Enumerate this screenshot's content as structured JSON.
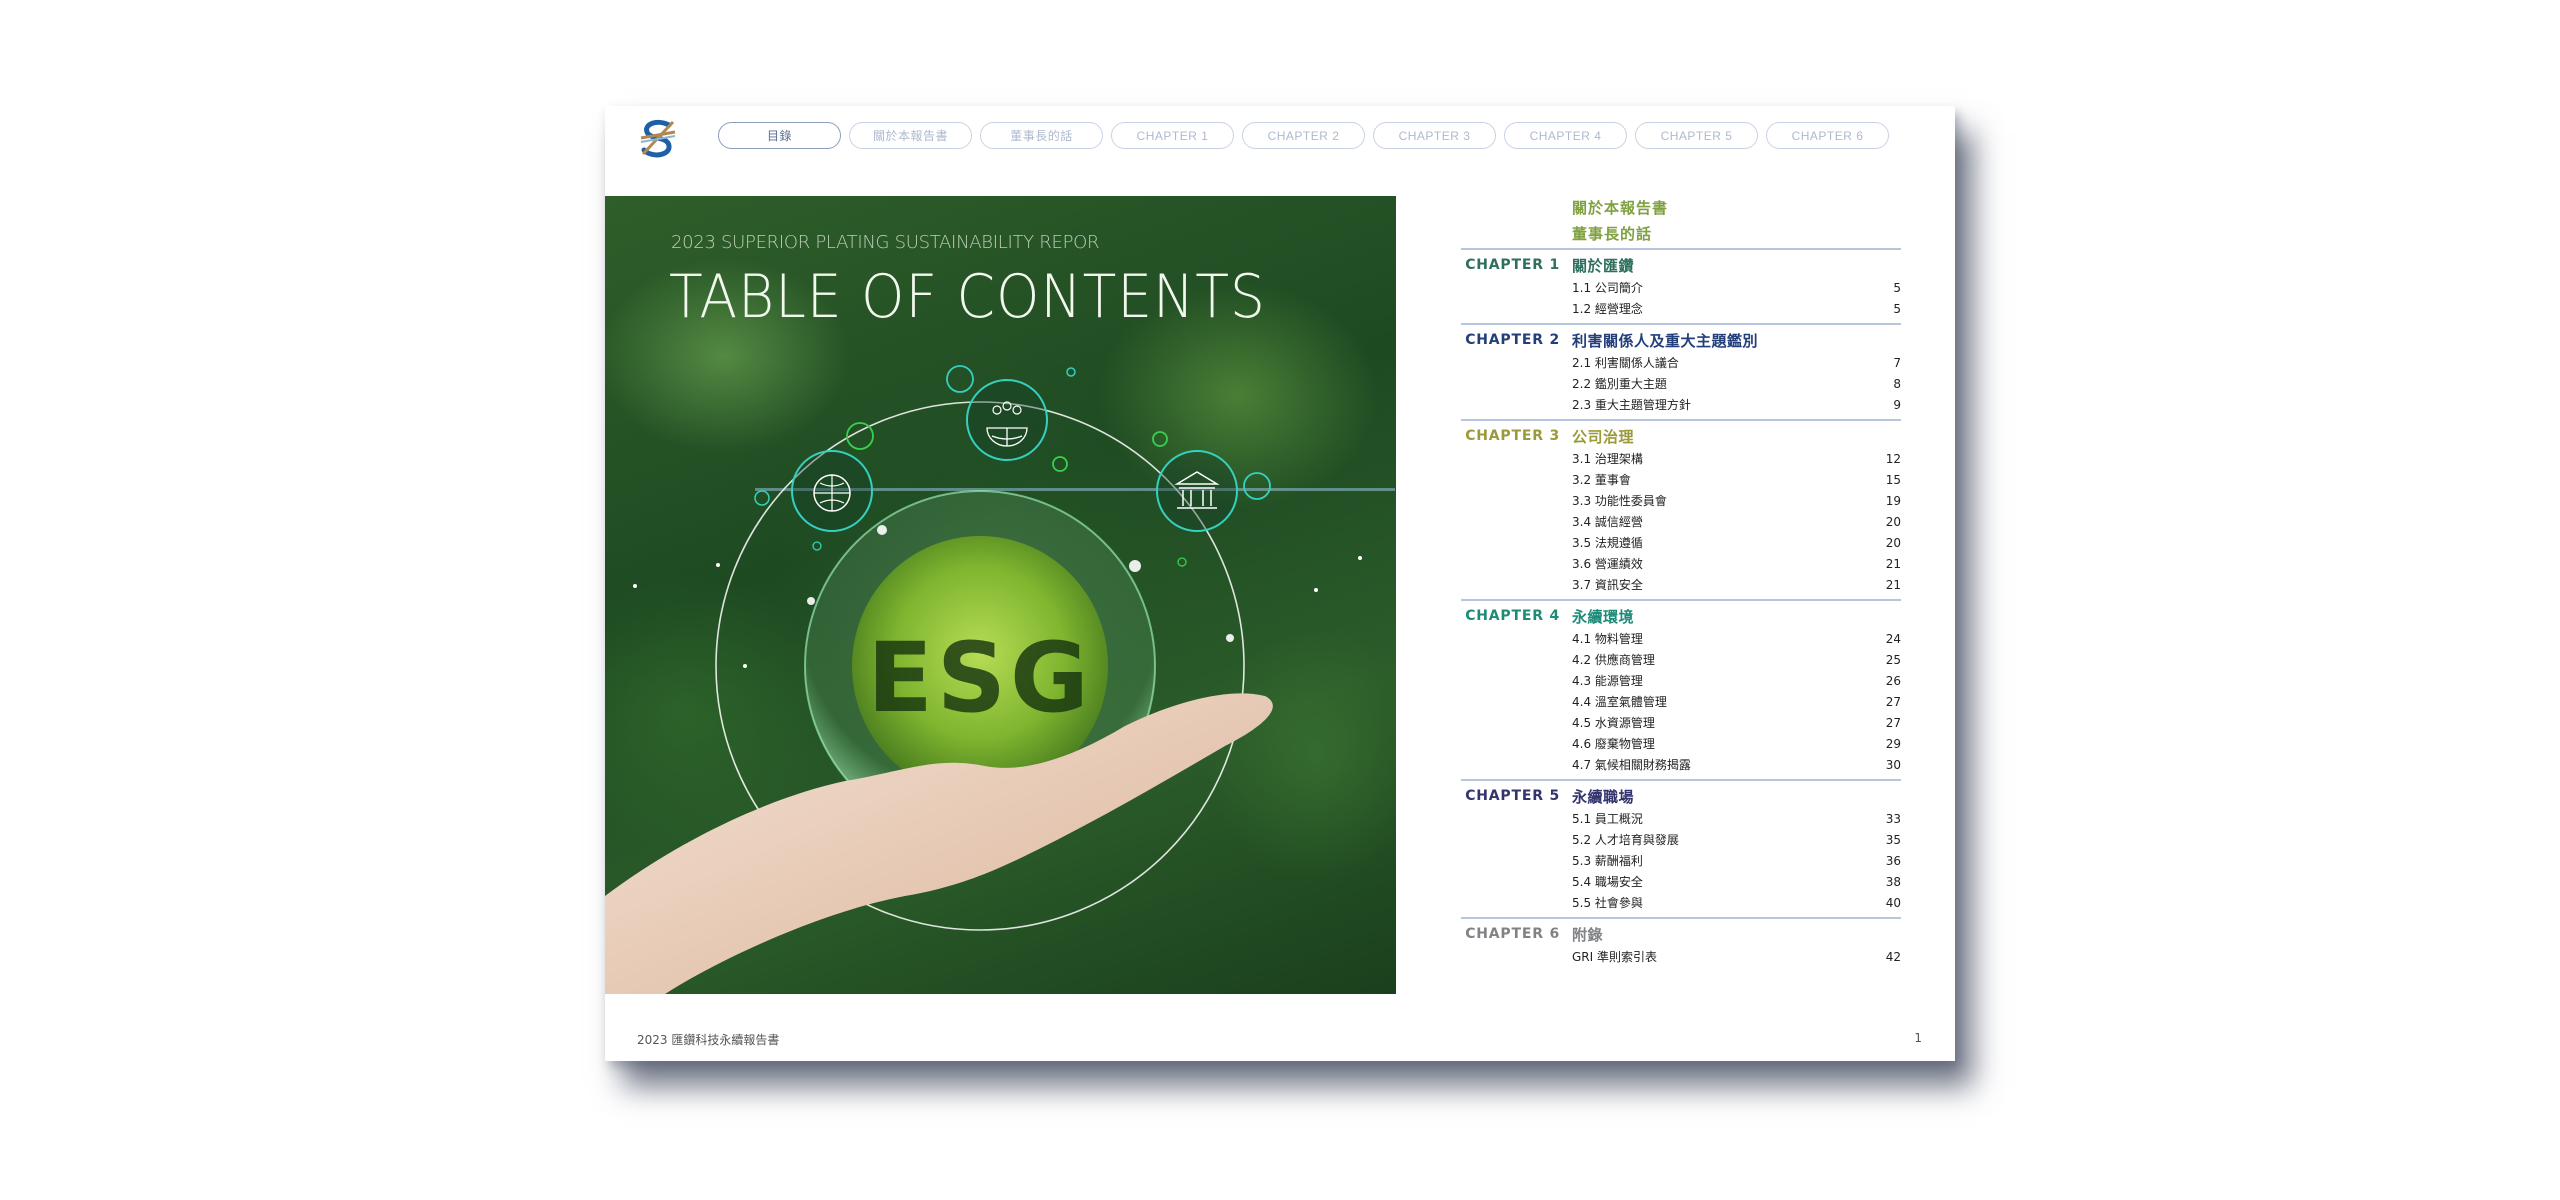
{
  "nav": {
    "tabs": [
      {
        "label": "目錄",
        "active": true
      },
      {
        "label": "關於本報告書",
        "active": false
      },
      {
        "label": "董事長的話",
        "active": false
      },
      {
        "label": "CHAPTER 1",
        "active": false
      },
      {
        "label": "CHAPTER 2",
        "active": false
      },
      {
        "label": "CHAPTER 3",
        "active": false
      },
      {
        "label": "CHAPTER 4",
        "active": false
      },
      {
        "label": "CHAPTER 5",
        "active": false
      },
      {
        "label": "CHAPTER 6",
        "active": false
      }
    ]
  },
  "hero": {
    "subtitle": "2023 SUPERIOR PLATING SUSTAINABILITY REPOR",
    "title": "TABLE OF CONTENTS",
    "badge_text": "ESG",
    "icons": [
      "globe-leaf-icon",
      "people-globe-icon",
      "bank-building-icon"
    ]
  },
  "toc": {
    "preface": [
      "關於本報告書",
      "董事長的話"
    ],
    "preface_color": "#7fa140",
    "chapters": [
      {
        "label": "CHAPTER 1",
        "title": "關於匯鑽",
        "color": "#2f6f5e",
        "items": [
          {
            "t": "1.1 公司簡介",
            "p": "5"
          },
          {
            "t": "1.2 經營理念",
            "p": "5"
          }
        ]
      },
      {
        "label": "CHAPTER 2",
        "title": "利害關係人及重大主題鑑別",
        "color": "#233f7a",
        "items": [
          {
            "t": "2.1 利害關係人議合",
            "p": "7"
          },
          {
            "t": "2.2 鑑別重大主題",
            "p": "8"
          },
          {
            "t": "2.3 重大主題管理方針",
            "p": "9"
          }
        ]
      },
      {
        "label": "CHAPTER 3",
        "title": "公司治理",
        "color": "#9a9a3a",
        "items": [
          {
            "t": "3.1 治理架構",
            "p": "12"
          },
          {
            "t": "3.2 董事會",
            "p": "15"
          },
          {
            "t": "3.3 功能性委員會",
            "p": "19"
          },
          {
            "t": "3.4 誠信經營",
            "p": "20"
          },
          {
            "t": "3.5 法規遵循",
            "p": "20"
          },
          {
            "t": "3.6 營運績效",
            "p": "21"
          },
          {
            "t": "3.7 資訊安全",
            "p": "21"
          }
        ]
      },
      {
        "label": "CHAPTER 4",
        "title": "永續環境",
        "color": "#1e8a78",
        "items": [
          {
            "t": "4.1 物料管理",
            "p": "24"
          },
          {
            "t": "4.2 供應商管理",
            "p": "25"
          },
          {
            "t": "4.3 能源管理",
            "p": "26"
          },
          {
            "t": "4.4 溫室氣體管理",
            "p": "27"
          },
          {
            "t": "4.5 水資源管理",
            "p": "27"
          },
          {
            "t": "4.6 廢棄物管理",
            "p": "29"
          },
          {
            "t": "4.7 氣候相關財務揭露",
            "p": "30"
          }
        ]
      },
      {
        "label": "CHAPTER 5",
        "title": "永續職場",
        "color": "#33336e",
        "items": [
          {
            "t": "5.1 員工概況",
            "p": "33"
          },
          {
            "t": "5.2 人才培育與發展",
            "p": "35"
          },
          {
            "t": "5.3 薪酬福利",
            "p": "36"
          },
          {
            "t": "5.4 職場安全",
            "p": "38"
          },
          {
            "t": "5.5 社會參與",
            "p": "40"
          }
        ]
      },
      {
        "label": "CHAPTER 6",
        "title": "附錄",
        "color": "#808285",
        "items": [
          {
            "t": "GRI 準則索引表",
            "p": "42"
          }
        ]
      }
    ]
  },
  "footer": {
    "left": "2023 匯鑽科技永續報告書",
    "page_number": "1"
  }
}
